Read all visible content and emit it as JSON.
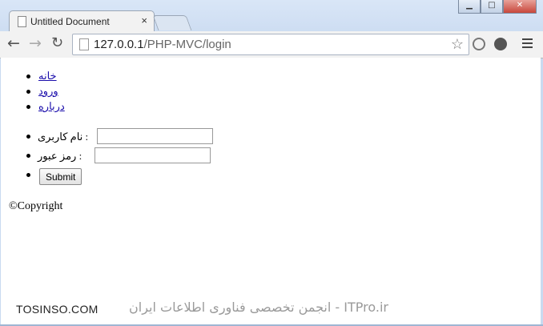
{
  "browser": {
    "tab_title": "Untitled Document",
    "tab_close": "×",
    "url_host": "127.0.0.1",
    "url_path": "/PHP-MVC/login",
    "window_buttons": [
      "▁",
      "□",
      "✕"
    ]
  },
  "nav": {
    "items": [
      "خانه",
      "ورود",
      "درباره"
    ]
  },
  "login_form": {
    "username_label": "نام کاربری :",
    "username_value": "",
    "password_label": "رمز عبور :",
    "password_value": "",
    "submit_label": "Submit"
  },
  "footer": {
    "copyright": "©Copyright"
  },
  "watermark": {
    "left": "TOSINSO.COM",
    "right": "ITPro.ir - انجمن تخصصی فناوری اطلاعات ایران"
  }
}
